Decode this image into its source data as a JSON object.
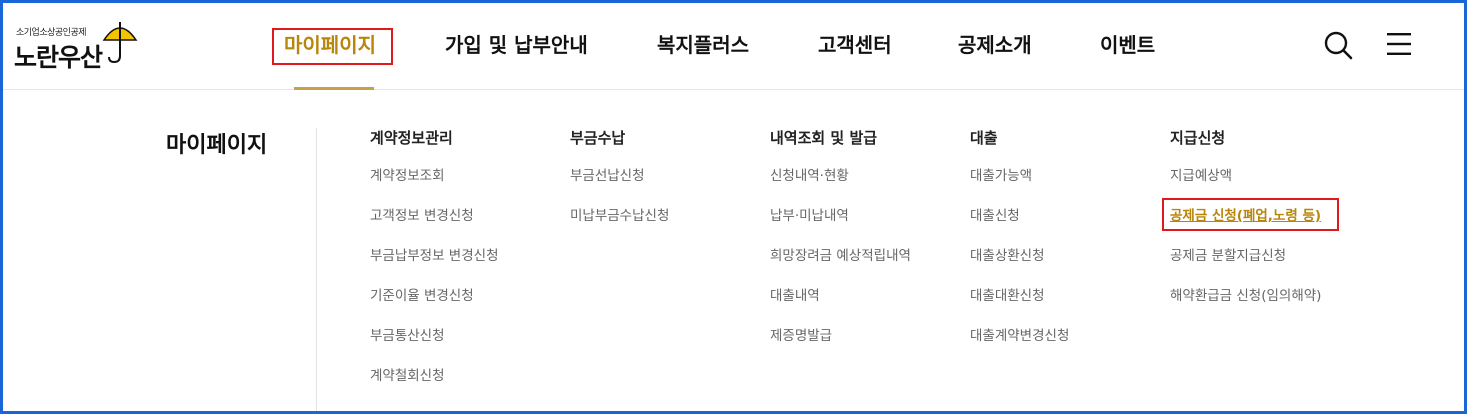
{
  "logo": {
    "subtitle": "소기업소상공인공제",
    "name": "노란우산"
  },
  "nav": {
    "items": [
      {
        "label": "마이페이지",
        "active": true
      },
      {
        "label": "가입 및 납부안내",
        "active": false
      },
      {
        "label": "복지플러스",
        "active": false
      },
      {
        "label": "고객센터",
        "active": false
      },
      {
        "label": "공제소개",
        "active": false
      },
      {
        "label": "이벤트",
        "active": false
      }
    ],
    "icons": [
      "search-icon",
      "menu-icon"
    ]
  },
  "colors": {
    "accent": "#b8860b",
    "highlight": "#e01a1a",
    "frame": "#1a66d6"
  },
  "mega_menu": {
    "title": "마이페이지",
    "columns": [
      {
        "heading": "계약정보관리",
        "links": [
          "계약정보조회",
          "고객정보 변경신청",
          "부금납부정보 변경신청",
          "기준이율 변경신청",
          "부금통산신청",
          "계약철회신청"
        ]
      },
      {
        "heading": "부금수납",
        "links": [
          "부금선납신청",
          "미납부금수납신청"
        ]
      },
      {
        "heading": "내역조회 및 발급",
        "links": [
          "신청내역·현황",
          "납부·미납내역",
          "희망장려금 예상적립내역",
          "대출내역",
          "제증명발급"
        ]
      },
      {
        "heading": "대출",
        "links": [
          "대출가능액",
          "대출신청",
          "대출상환신청",
          "대출대환신청",
          "대출계약변경신청"
        ]
      },
      {
        "heading": "지급신청",
        "links": [
          "지급예상액",
          "공제금 신청(폐업,노령 등)",
          "공제금 분할지급신청",
          "해약환급금 신청(임의해약)"
        ],
        "featured_index": 1
      }
    ]
  }
}
